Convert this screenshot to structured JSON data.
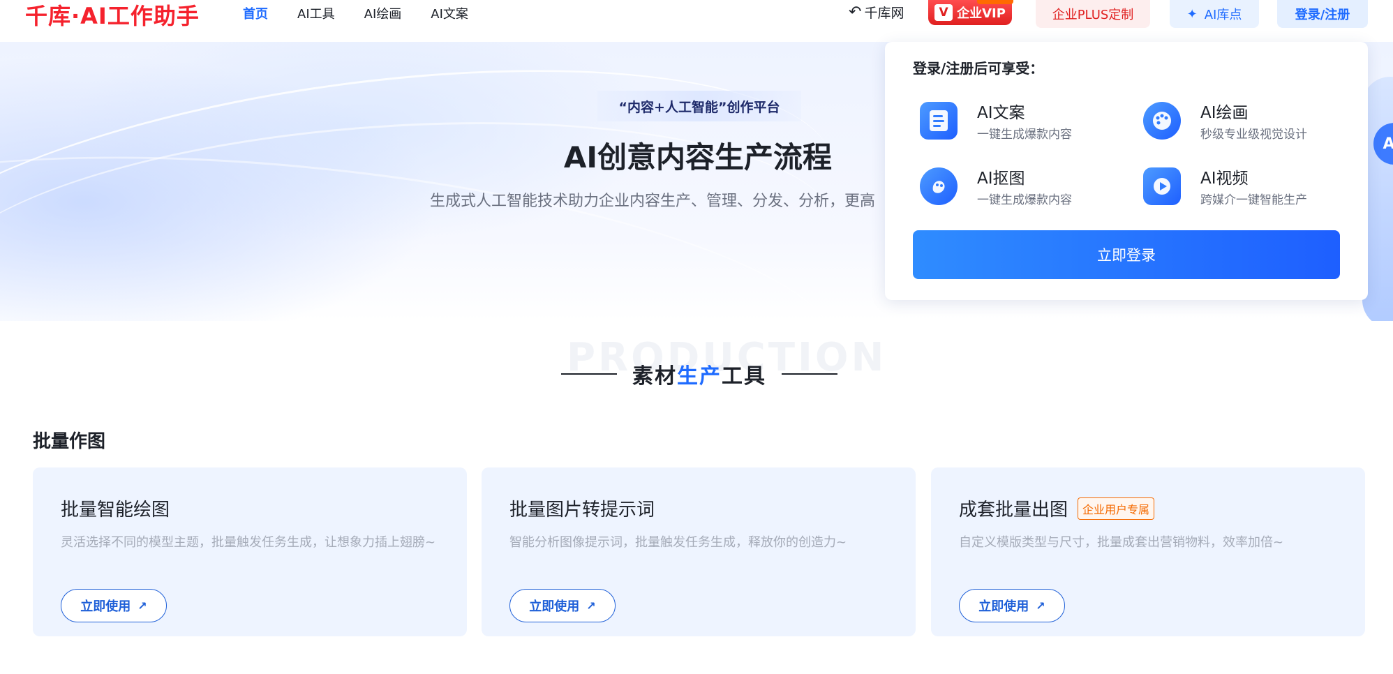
{
  "header": {
    "logo": "千库·AI工作助手",
    "nav": [
      "首页",
      "AI工具",
      "AI绘画",
      "AI文案"
    ],
    "back_link": "千库网",
    "vip_label": "企业VIP",
    "plus_label": "企业PLUS定制",
    "ai_points_label": "AI库点",
    "login_label": "登录/注册"
  },
  "hero": {
    "tag": "“内容+人工智能”创作平台",
    "title": "AI创意内容生产流程",
    "subtitle": "生成式人工智能技术助力企业内容生产、管理、分发、分析，更高"
  },
  "popover": {
    "title": "登录/注册后可享受：",
    "features": [
      {
        "name": "AI文案",
        "desc": "一键生成爆款内容",
        "icon": "document-icon"
      },
      {
        "name": "AI绘画",
        "desc": "秒级专业级视觉设计",
        "icon": "palette-icon"
      },
      {
        "name": "AI抠图",
        "desc": "一键生成爆款内容",
        "icon": "cutout-icon"
      },
      {
        "name": "AI视频",
        "desc": "跨媒介一键智能生产",
        "icon": "video-icon"
      }
    ],
    "button": "立即登录"
  },
  "section": {
    "bg_word": "PRODUCTION",
    "title_a": "素材",
    "title_hl": "生产",
    "title_b": "工具",
    "group": "批量作图"
  },
  "cards": [
    {
      "title": "批量智能绘图",
      "badge": "",
      "desc": "灵活选择不同的模型主题，批量触发任务生成，让想象力插上翅膀~",
      "button": "立即使用"
    },
    {
      "title": "批量图片转提示词",
      "badge": "",
      "desc": "智能分析图像提示词，批量触发任务生成，释放你的创造力~",
      "button": "立即使用"
    },
    {
      "title": "成套批量出图",
      "badge": "企业用户专属",
      "desc": "自定义模版类型与尺寸，批量成套出营销物料，效率加倍~",
      "button": "立即使用"
    }
  ],
  "colors": {
    "brand_red": "#f5222d",
    "brand_blue": "#1e6bff",
    "badge_orange": "#f56a00"
  }
}
